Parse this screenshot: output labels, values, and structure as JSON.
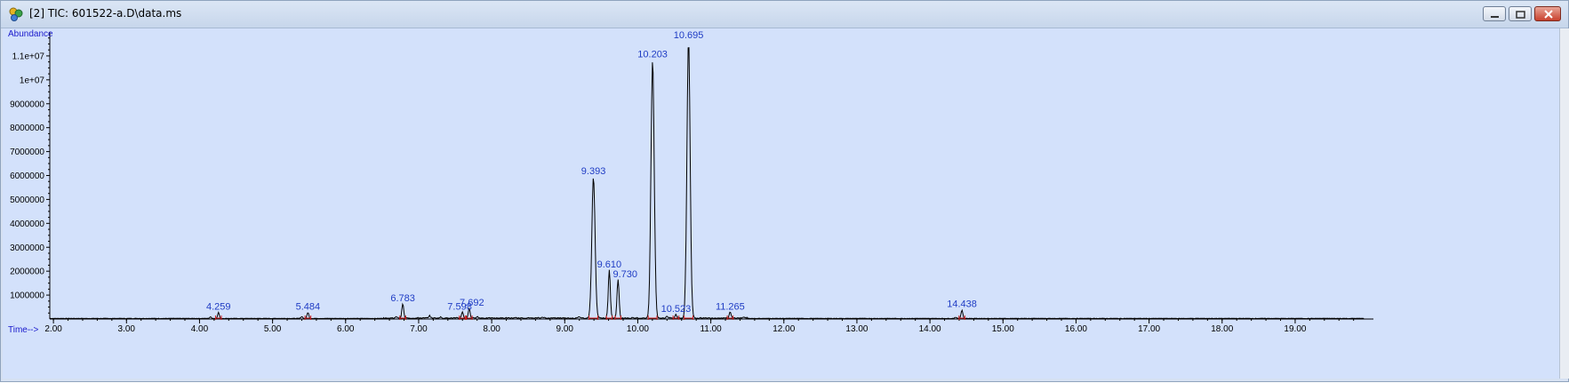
{
  "window": {
    "title": "[2] TIC: 601522-a.D\\data.ms",
    "icon": "chromatogram-app-icon",
    "buttons": [
      "minimize-icon",
      "restore-icon",
      "close-icon"
    ]
  },
  "colors": {
    "background": "#d3e1fb",
    "trace": "#000000",
    "baseline_marker": "#d22020",
    "labels": "#1f3cc4",
    "axis_names": "#1a1acc"
  },
  "chart_data": {
    "type": "line",
    "title": "",
    "xlabel": "Time-->",
    "ylabel": "Abundance",
    "xlim": [
      1.95,
      19.95
    ],
    "ylim": [
      0,
      12000000
    ],
    "x_ticks": [
      2.0,
      3.0,
      4.0,
      5.0,
      6.0,
      7.0,
      8.0,
      9.0,
      10.0,
      11.0,
      12.0,
      13.0,
      14.0,
      15.0,
      16.0,
      17.0,
      18.0,
      19.0
    ],
    "x_tick_labels": [
      "2.00",
      "3.00",
      "4.00",
      "5.00",
      "6.00",
      "7.00",
      "8.00",
      "9.00",
      "10.00",
      "11.00",
      "12.00",
      "13.00",
      "14.00",
      "15.00",
      "16.00",
      "17.00",
      "18.00",
      "19.00"
    ],
    "y_ticks": [
      1000000,
      2000000,
      3000000,
      4000000,
      5000000,
      6000000,
      7000000,
      8000000,
      9000000,
      10000000,
      11000000
    ],
    "y_tick_labels": [
      "1000000",
      "2000000",
      "3000000",
      "4000000",
      "5000000",
      "6000000",
      "7000000",
      "8000000",
      "9000000",
      "1e+07",
      "1.1e+07"
    ],
    "grid": false,
    "peaks": [
      {
        "rt": 4.259,
        "label": "4.259",
        "abundance": 250000
      },
      {
        "rt": 5.484,
        "label": "5.484",
        "abundance": 250000
      },
      {
        "rt": 6.783,
        "label": "6.783",
        "abundance": 600000
      },
      {
        "rt": 7.598,
        "label": "7.598",
        "abundance": 250000
      },
      {
        "rt": 7.692,
        "label": "7.692",
        "abundance": 400000
      },
      {
        "rt": 9.393,
        "label": "9.393",
        "abundance": 5900000
      },
      {
        "rt": 9.61,
        "label": "9.610",
        "abundance": 2000000
      },
      {
        "rt": 9.73,
        "label": "9.730",
        "abundance": 1600000
      },
      {
        "rt": 10.203,
        "label": "10.203",
        "abundance": 10800000
      },
      {
        "rt": 10.523,
        "label": "10.523",
        "abundance": 150000
      },
      {
        "rt": 10.695,
        "label": "10.695",
        "abundance": 11600000
      },
      {
        "rt": 11.265,
        "label": "11.265",
        "abundance": 250000
      },
      {
        "rt": 14.438,
        "label": "14.438",
        "abundance": 350000
      }
    ],
    "minor_peaks": [
      {
        "rt": 4.15,
        "abundance": 60000
      },
      {
        "rt": 5.4,
        "abundance": 80000
      },
      {
        "rt": 6.7,
        "abundance": 50000
      },
      {
        "rt": 7.15,
        "abundance": 90000
      },
      {
        "rt": 7.3,
        "abundance": 40000
      },
      {
        "rt": 7.8,
        "abundance": 60000
      },
      {
        "rt": 8.7,
        "abundance": 40000
      },
      {
        "rt": 9.2,
        "abundance": 50000
      },
      {
        "rt": 10.4,
        "abundance": 80000
      },
      {
        "rt": 11.45,
        "abundance": 40000
      },
      {
        "rt": 14.35,
        "abundance": 50000
      }
    ]
  }
}
